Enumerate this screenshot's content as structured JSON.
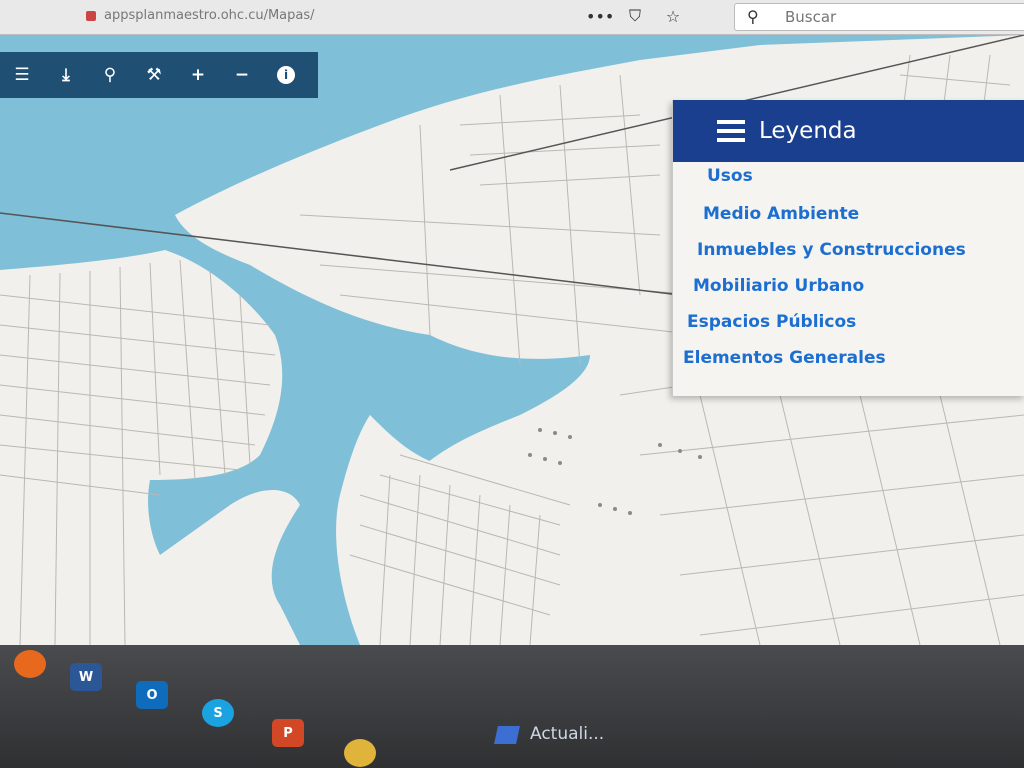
{
  "browser": {
    "url": "appsplanmaestro.ohc.cu/Mapas/",
    "more_icon": "ellipsis-icon",
    "pocket_icon": "pocket-icon",
    "bookmark_icon": "star-icon",
    "search_placeholder": "Buscar"
  },
  "toolbar": {
    "buttons": [
      {
        "name": "layers",
        "icon": "list-icon",
        "glyph": "☰"
      },
      {
        "name": "download",
        "icon": "download-icon",
        "glyph": "⤓"
      },
      {
        "name": "search",
        "icon": "search-icon",
        "glyph": "⚲"
      },
      {
        "name": "tools",
        "icon": "wrench-icon",
        "glyph": "⚒"
      },
      {
        "name": "zoom-in",
        "icon": "plus-icon",
        "glyph": "+"
      },
      {
        "name": "zoom-out",
        "icon": "minus-icon",
        "glyph": "−"
      },
      {
        "name": "info",
        "icon": "info-icon",
        "glyph": "i"
      }
    ]
  },
  "legend": {
    "title": "Leyenda",
    "items": [
      "Usos",
      "Medio Ambiente",
      "Inmuebles y Construcciones",
      "Mobiliario Urbano",
      "Espacios Públicos",
      "Elementos Generales"
    ]
  },
  "taskbar": {
    "apps": [
      {
        "name": "firefox",
        "icon": "firefox-icon",
        "label": "",
        "color": "#e8691e"
      },
      {
        "name": "word",
        "icon": "word-icon",
        "label": "W",
        "color": "#2b5797"
      },
      {
        "name": "outlook",
        "icon": "outlook-icon",
        "label": "O",
        "color": "#0f6cbd"
      },
      {
        "name": "skype",
        "icon": "skype-icon",
        "label": "S",
        "color": "#1aa3e0"
      },
      {
        "name": "powerpoint",
        "icon": "powerpoint-icon",
        "label": "P",
        "color": "#d24726"
      },
      {
        "name": "chrome",
        "icon": "chrome-icon",
        "label": "",
        "color": "#e0b43a"
      }
    ],
    "notification": "Actuali..."
  },
  "colors": {
    "water": "#7fbfd8",
    "toolbar": "#1f4f73",
    "legend_header": "#1b3f8f",
    "legend_link": "#1c6fd0"
  }
}
